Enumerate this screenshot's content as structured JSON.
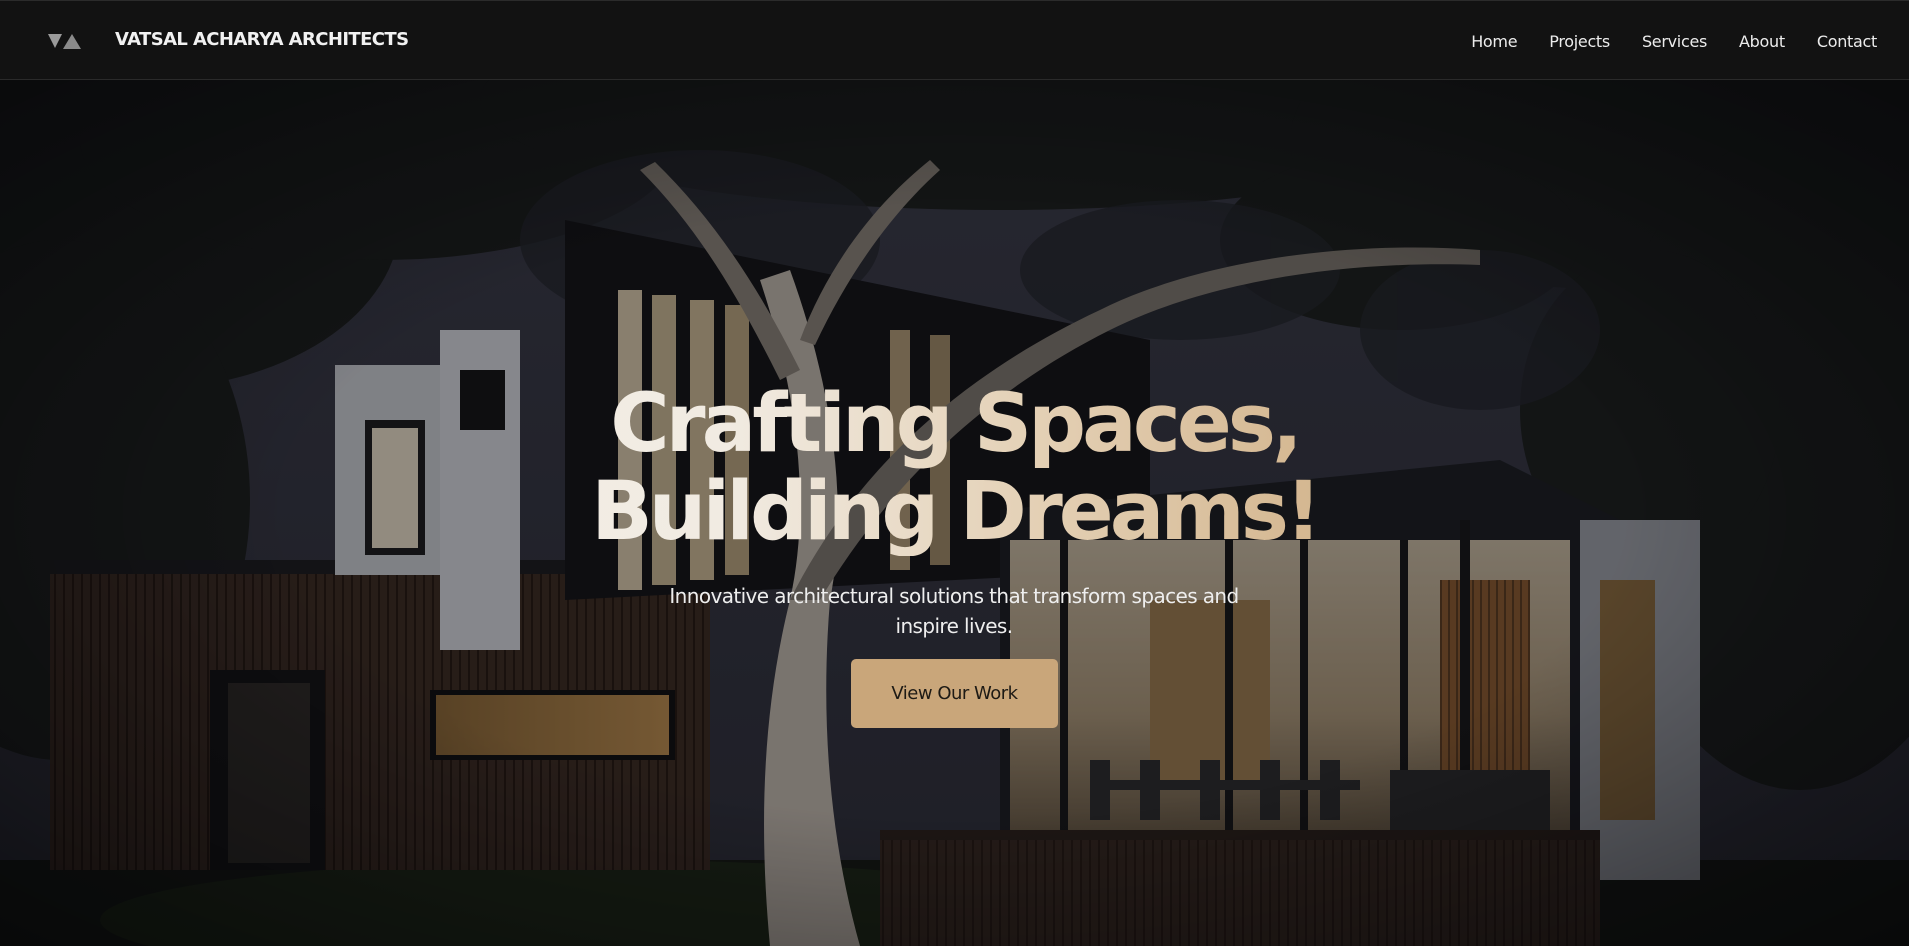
{
  "header": {
    "logo_icon": "triangle-logo-icon",
    "brand": "VATSAL ACHARYA ARCHITECTS"
  },
  "nav": {
    "items": [
      "Home",
      "Projects",
      "Services",
      "About",
      "Contact"
    ]
  },
  "hero": {
    "title_line1": "Crafting Spaces,",
    "title_line2": "Building Dreams!",
    "subtitle": "Innovative architectural solutions that transform spaces and inspire lives.",
    "cta_label": "View Our Work",
    "background": "night-modern-house-photo"
  },
  "colors": {
    "navbar_bg": "#121212",
    "accent": "#c9a67a",
    "title_gradient_start": "#f4f0ea",
    "title_gradient_end": "#d3b58e"
  }
}
